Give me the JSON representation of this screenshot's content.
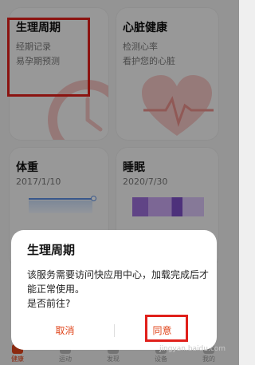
{
  "cards": {
    "period": {
      "title": "生理周期",
      "line1": "经期记录",
      "line2": "易孕期预测"
    },
    "heart": {
      "title": "心脏健康",
      "line1": "检测心率",
      "line2": "看护您的心脏"
    },
    "weight": {
      "title": "体重",
      "date": "2017/1/10",
      "level": 0.45
    },
    "sleep": {
      "title": "睡眠",
      "date": "2020/7/30"
    }
  },
  "dialog": {
    "title": "生理周期",
    "message": "该服务需要访问快应用中心，加载完成后才能正常使用。",
    "question": "是否前往?",
    "cancel_label": "取消",
    "confirm_label": "同意"
  },
  "tabs": [
    "健康",
    "运动",
    "发现",
    "设备",
    "我的"
  ],
  "watermark": "jingyan.baidu.com",
  "colors": {
    "accent": "#e0451b",
    "highlight": "#e0201b"
  }
}
